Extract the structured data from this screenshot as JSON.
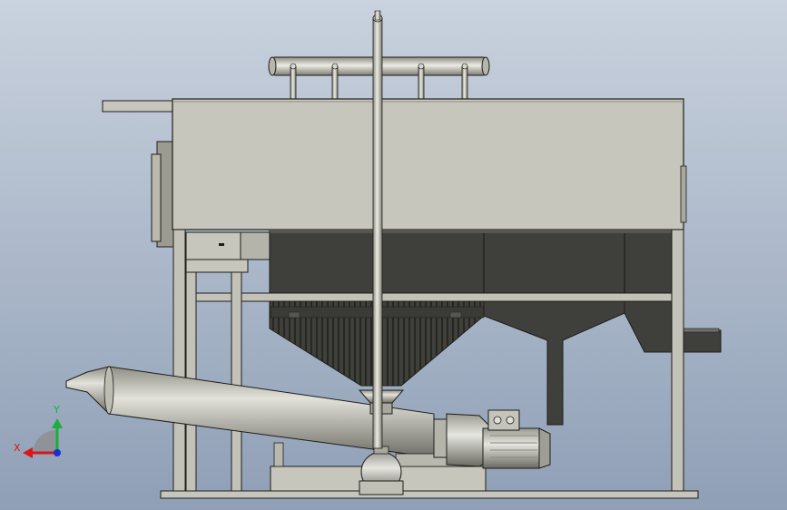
{
  "view": {
    "background_top": "#c9d2de",
    "background_bottom": "#8f9fb6"
  },
  "colors": {
    "body_light": "#c9c9bf",
    "body_mid": "#b3b3a8",
    "body_dark": "#3f403b",
    "edge": "#1e1e1a",
    "frame": "#c2c2b8",
    "pipe_light": "#e4e4dc",
    "pipe_dark": "#8a8a80"
  },
  "triad": {
    "x_label": "X",
    "y_label": "Y",
    "x_color": "#d81818",
    "y_color": "#16b03a",
    "z_color": "#1a2fd0"
  }
}
